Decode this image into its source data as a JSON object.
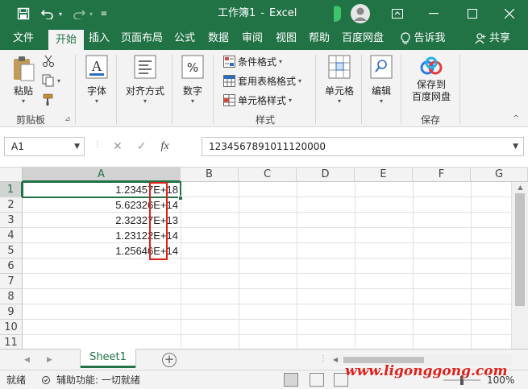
{
  "window": {
    "title": "工作簿1",
    "title_separator": "-",
    "app_name": "Excel",
    "accent_color": "#217346"
  },
  "tabs": [
    {
      "label": "文件"
    },
    {
      "label": "开始"
    },
    {
      "label": "插入"
    },
    {
      "label": "页面布局"
    },
    {
      "label": "公式"
    },
    {
      "label": "数据"
    },
    {
      "label": "审阅"
    },
    {
      "label": "视图"
    },
    {
      "label": "帮助"
    },
    {
      "label": "百度网盘"
    },
    {
      "label": "告诉我"
    },
    {
      "label": "共享"
    }
  ],
  "ribbon": {
    "clipboard": {
      "paste": "粘贴",
      "group": "剪贴板"
    },
    "font": {
      "label": "字体"
    },
    "alignment": {
      "label": "对齐方式"
    },
    "number": {
      "label": "数字"
    },
    "styles": {
      "conditional": "条件格式",
      "table": "套用表格格式",
      "cell_styles": "单元格样式",
      "group": "样式"
    },
    "cells": {
      "label": "单元格"
    },
    "editing": {
      "label": "编辑"
    },
    "save": {
      "line1": "保存到",
      "line2": "百度网盘",
      "group": "保存"
    }
  },
  "formula_bar": {
    "name_box": "A1",
    "fx": "fx",
    "value": "1234567891011120000"
  },
  "grid": {
    "columns": [
      "A",
      "B",
      "C",
      "D",
      "E",
      "F",
      "G"
    ],
    "rows": [
      "1",
      "2",
      "3",
      "4",
      "5",
      "6",
      "7",
      "8",
      "9",
      "10",
      "11"
    ],
    "cells": [
      {
        "mantissa": "1.23457",
        "exp": "E+",
        "power": "18"
      },
      {
        "mantissa": "5.62326",
        "exp": "E+",
        "power": "14"
      },
      {
        "mantissa": "2.32327",
        "exp": "E+",
        "power": "13"
      },
      {
        "mantissa": "1.23122",
        "exp": "E+",
        "power": "14"
      },
      {
        "mantissa": "1.25646",
        "exp": "E+",
        "power": "14"
      }
    ]
  },
  "sheets": [
    {
      "name": "Sheet1"
    }
  ],
  "status": {
    "ready": "就绪",
    "accessibility": "辅助功能: 一切就绪",
    "zoom": "100%"
  },
  "watermark": "www.ligonggong.com"
}
